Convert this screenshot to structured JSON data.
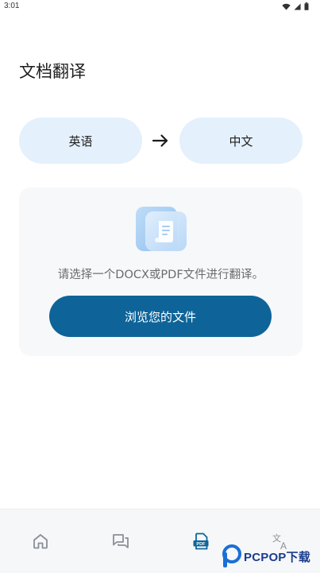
{
  "status_bar": {
    "time": "3:01",
    "icons": [
      "wifi-icon",
      "signal-icon",
      "battery-icon"
    ]
  },
  "page": {
    "title": "文档翻译"
  },
  "languages": {
    "source": "英语",
    "target": "中文",
    "arrow_icon": "arrow-right-icon"
  },
  "upload": {
    "illustration_icon": "document-icon",
    "hint": "请选择一个DOCX或PDF文件进行翻译。",
    "browse_label": "浏览您的文件"
  },
  "bottom_nav": {
    "items": [
      {
        "icon": "home-icon",
        "active": false
      },
      {
        "icon": "chat-icon",
        "active": false
      },
      {
        "icon": "pdf-icon",
        "active": true
      },
      {
        "icon": "translate-icon",
        "active": false
      }
    ]
  },
  "watermark": {
    "text": "PCPOP下载"
  },
  "colors": {
    "accent": "#0e6498",
    "pill": "#e4f0fc",
    "card": "#f7f8fa",
    "nav_inactive": "#8a8f96",
    "nav_active": "#0e6498"
  }
}
